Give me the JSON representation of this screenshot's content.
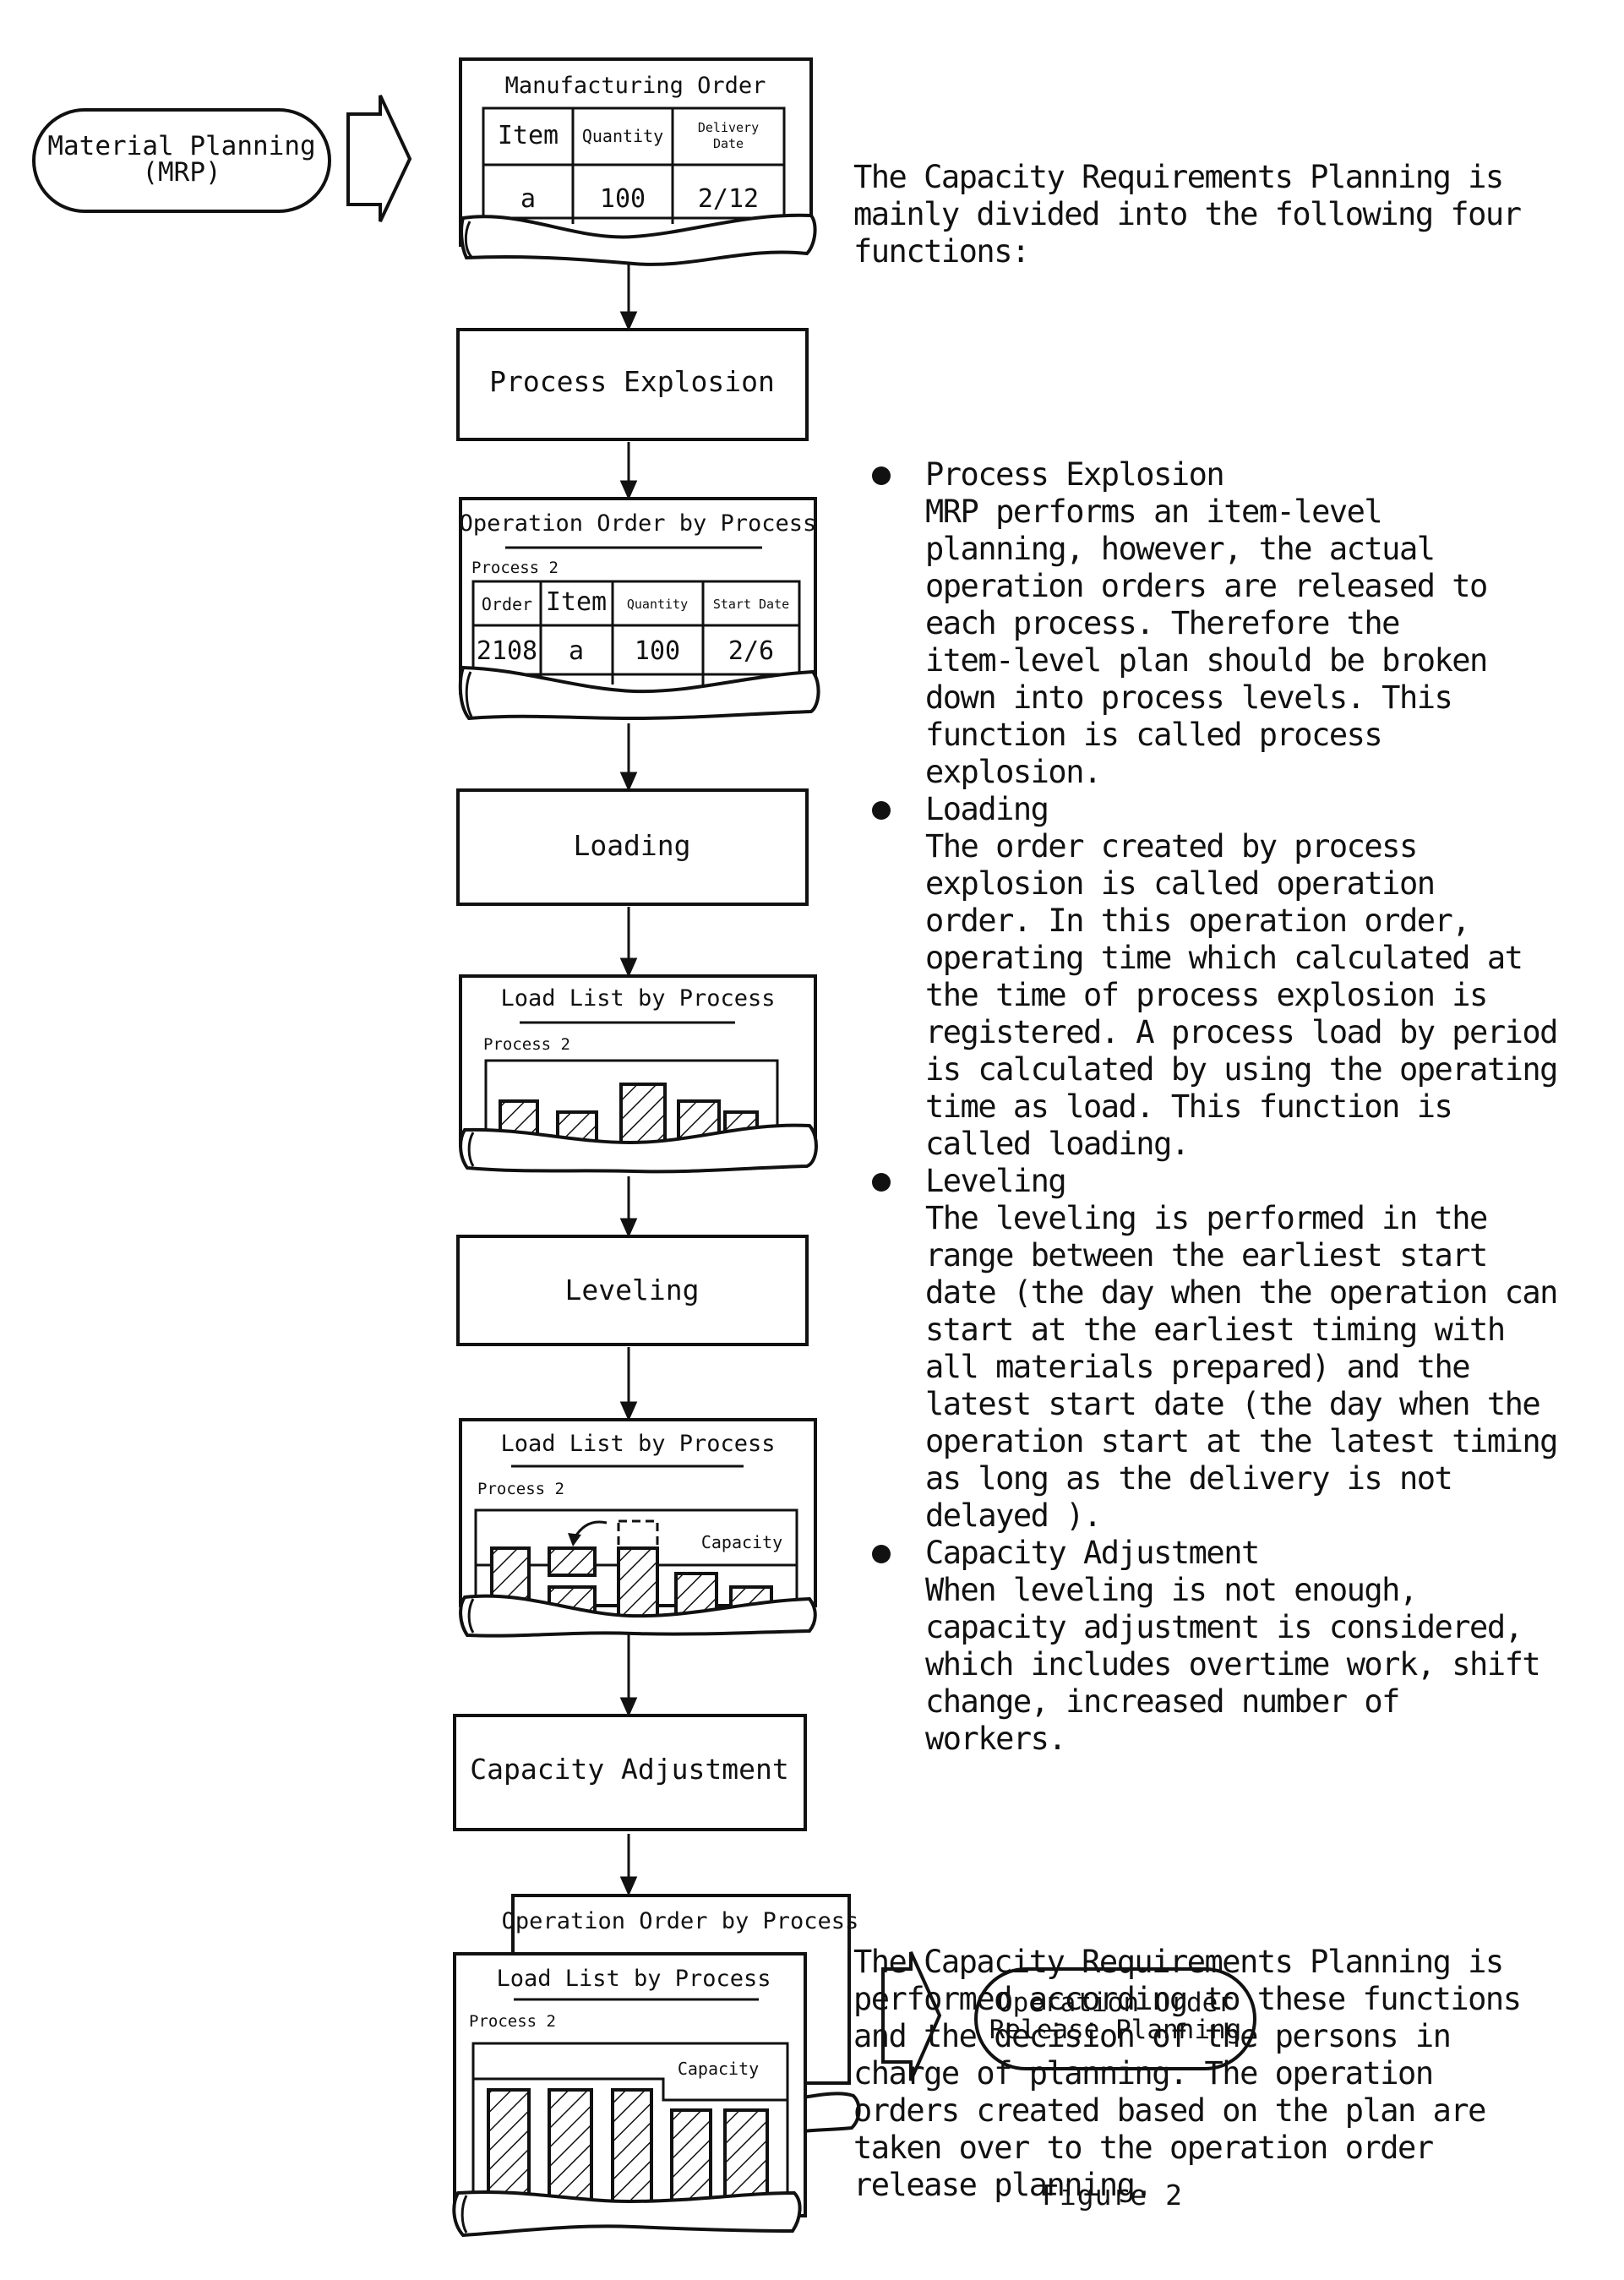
{
  "flow": {
    "start_pill": {
      "line1": "Material Planning",
      "line2": "(MRP)"
    },
    "manufacturing_order": {
      "title": "Manufacturing Order",
      "headers": [
        "Item",
        "Quantity",
        "Delivery",
        "Date"
      ],
      "row": [
        "a",
        "100",
        "2/12"
      ]
    },
    "process_explosion": "Process Explosion",
    "operation_order": {
      "title": "Operation Order by Process",
      "process": "Process 2",
      "headers": [
        "Order",
        "Item",
        "Quantity",
        "Start Date"
      ],
      "row": [
        "2108",
        "a",
        "100",
        "2/6"
      ]
    },
    "loading": "Loading",
    "load_list_1": {
      "title": "Load List by Process",
      "process": "Process 2"
    },
    "leveling": "Leveling",
    "load_list_2": {
      "title": "Load List by Process",
      "process": "Process 2",
      "capacity_label": "Capacity"
    },
    "capacity_adjustment": "Capacity Adjustment",
    "final_back": {
      "title": "Operation Order by Process"
    },
    "final_front": {
      "title": "Load List by Process",
      "process": "Process 2",
      "capacity_label": "Capacity"
    },
    "end_pill": {
      "line1": "Operation Order",
      "line2": "Release Planning"
    }
  },
  "text": {
    "intro": [
      "The Capacity Requirements Planning is",
      "mainly divided into the following four",
      "functions:"
    ],
    "bullets": [
      {
        "title": "Process Explosion",
        "lines": [
          "MRP performs an item-level",
          "planning, however, the actual",
          "operation orders are released to",
          "each process. Therefore the",
          "item-level plan should be broken",
          "down into process levels. This",
          "function is called process",
          "explosion."
        ]
      },
      {
        "title": "Loading",
        "lines": [
          "The order created by process",
          "explosion is called operation",
          "order. In this operation order,",
          "operating time which calculated at",
          "the time of process explosion is",
          "registered. A process load by period",
          "is calculated by using the operating",
          "time as load. This function is",
          "called loading."
        ]
      },
      {
        "title": "Leveling",
        "lines": [
          "The leveling is performed in the",
          "range between the earliest start",
          "date (the day when the operation can",
          "start at the earliest timing with",
          "all materials prepared) and the",
          "latest start date (the day when the",
          "operation start at the latest timing",
          "as long as the delivery is not",
          "delayed )."
        ]
      },
      {
        "title": "Capacity Adjustment",
        "lines": [
          "When leveling is not enough,",
          "capacity adjustment is considered,",
          "which includes overtime work, shift",
          "change, increased number of",
          "workers."
        ]
      }
    ],
    "closing": [
      "The Capacity Requirements Planning is",
      "performed according to these functions",
      "and the decision of the persons in",
      "charge of planning. The operation",
      "orders created based on the plan are",
      "taken over to the operation order",
      "release planning."
    ]
  },
  "caption": "Figure 2"
}
